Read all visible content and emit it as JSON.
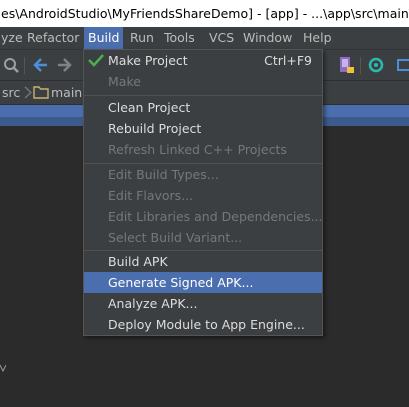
{
  "window": {
    "title": "es\\AndroidStudio\\MyFriendsShareDemo] - [app] - ...\\app\\src\\main\\And"
  },
  "menubar": {
    "items": [
      {
        "id": "analyze",
        "label": "yze"
      },
      {
        "id": "refactor",
        "label": "Refactor"
      },
      {
        "id": "build",
        "label": "Build"
      },
      {
        "id": "run",
        "label": "Run"
      },
      {
        "id": "tools",
        "label": "Tools"
      },
      {
        "id": "vcs",
        "label": "VCS"
      },
      {
        "id": "window",
        "label": "Window"
      },
      {
        "id": "help",
        "label": "Help"
      }
    ],
    "active": "Build"
  },
  "navbar": {
    "crumbs": [
      "src",
      "main"
    ]
  },
  "build_menu": {
    "items": [
      {
        "label": "Make Project",
        "shortcut": "Ctrl+F9",
        "enabled": true,
        "icon": "hammer-check-icon"
      },
      {
        "label": "Make",
        "shortcut": "",
        "enabled": false
      },
      {
        "label": "Clean Project",
        "shortcut": "",
        "enabled": true
      },
      {
        "label": "Rebuild Project",
        "shortcut": "",
        "enabled": true
      },
      {
        "label": "Refresh Linked C++ Projects",
        "shortcut": "",
        "enabled": false
      },
      {
        "label": "Edit Build Types...",
        "shortcut": "",
        "enabled": false
      },
      {
        "label": "Edit Flavors...",
        "shortcut": "",
        "enabled": false
      },
      {
        "label": "Edit Libraries and Dependencies...",
        "shortcut": "",
        "enabled": false
      },
      {
        "label": "Select Build Variant...",
        "shortcut": "",
        "enabled": false
      },
      {
        "label": "Build APK",
        "shortcut": "",
        "enabled": true
      },
      {
        "label": "Generate Signed APK...",
        "shortcut": "",
        "enabled": true,
        "highlighted": true
      },
      {
        "label": "Analyze APK...",
        "shortcut": "",
        "enabled": true
      },
      {
        "label": "Deploy Module to App Engine...",
        "shortcut": "",
        "enabled": true
      }
    ]
  },
  "colors": {
    "background": "#2b2b2b",
    "chrome": "#3c3f41",
    "accent": "#4b6eaf",
    "text": "#bbbbbb",
    "disabled_text": "#777777",
    "check_green": "#4caf50"
  }
}
